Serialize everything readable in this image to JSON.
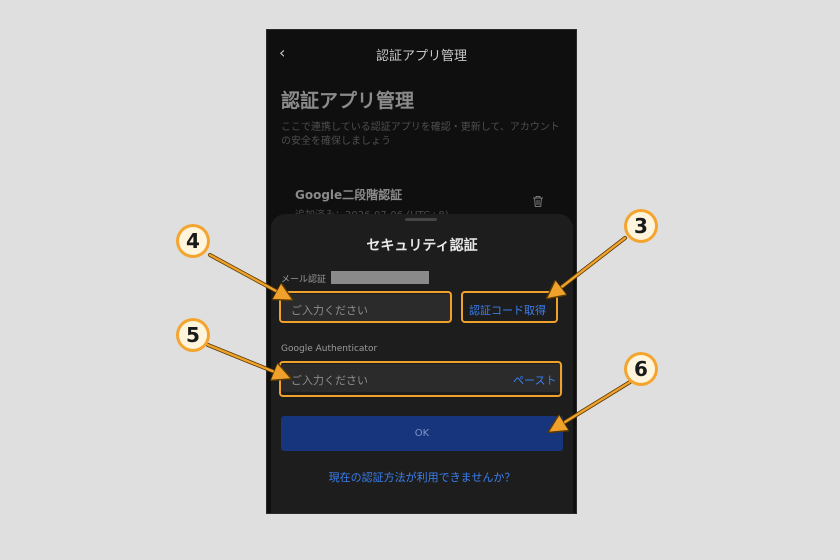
{
  "app": {
    "nav_back": "‹",
    "nav_title": "認証アプリ管理",
    "page_title": "認証アプリ管理",
    "description": "ここで連携している認証アプリを確認・更新して、アカウントの安全を確保しましょう",
    "authenticator": {
      "title": "Google二段階認証",
      "added": "追加済み：2026-07-06 (UTC+8)"
    }
  },
  "dialog": {
    "title": "セキュリティ認証",
    "email_label": "メール認証",
    "email_placeholder": "ご入力ください",
    "get_code": "認証コード取得",
    "ga_label": "Google Authenticator",
    "ga_placeholder": "ご入力ください",
    "paste": "ペースト",
    "ok": "OK",
    "alt_link": "現在の認証方法が利用できませんか？"
  },
  "annotations": {
    "n3": "3",
    "n4": "4",
    "n5": "5",
    "n6": "6"
  },
  "colors": {
    "accent": "#3a7ff0",
    "highlight": "#f0a12c",
    "ok_button": "#17357d"
  }
}
